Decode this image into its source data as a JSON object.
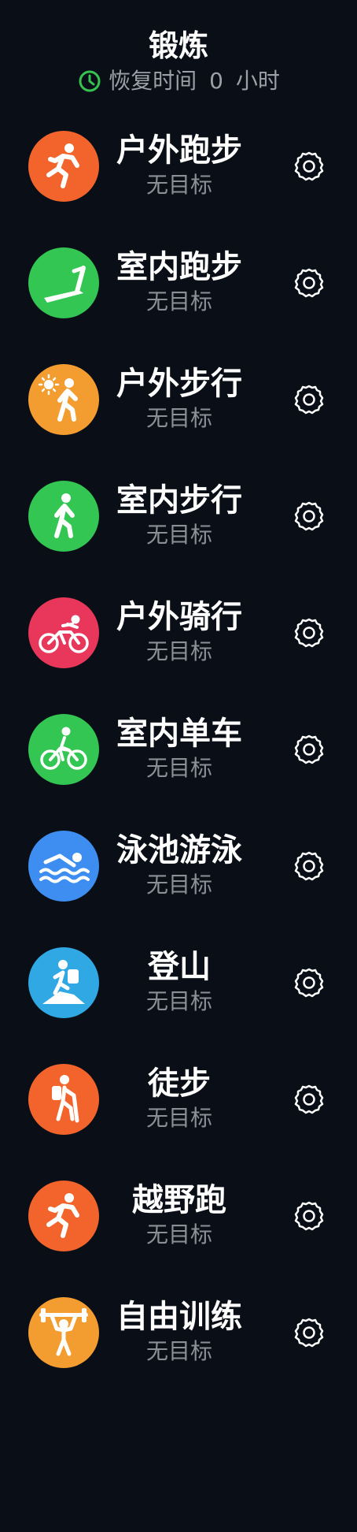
{
  "header": {
    "title": "锻炼",
    "recovery_label": "恢复时间",
    "recovery_value": "0",
    "recovery_unit": "小时",
    "recovery_icon": "clock-icon",
    "recovery_color": "#37c34f"
  },
  "workouts": [
    {
      "label": "户外跑步",
      "subtitle": "无目标",
      "icon": "running-icon",
      "color": "#f2642c"
    },
    {
      "label": "室内跑步",
      "subtitle": "无目标",
      "icon": "treadmill-icon",
      "color": "#33c653"
    },
    {
      "label": "户外步行",
      "subtitle": "无目标",
      "icon": "outdoor-walk-icon",
      "color": "#f39c30"
    },
    {
      "label": "室内步行",
      "subtitle": "无目标",
      "icon": "walking-icon",
      "color": "#33c653"
    },
    {
      "label": "户外骑行",
      "subtitle": "无目标",
      "icon": "cycling-icon",
      "color": "#e8375a"
    },
    {
      "label": "室内单车",
      "subtitle": "无目标",
      "icon": "indoor-bike-icon",
      "color": "#33c653"
    },
    {
      "label": "泳池游泳",
      "subtitle": "无目标",
      "icon": "swimming-icon",
      "color": "#3d8ef0"
    },
    {
      "label": "登山",
      "subtitle": "无目标",
      "icon": "climbing-icon",
      "color": "#2fa8e4"
    },
    {
      "label": "徒步",
      "subtitle": "无目标",
      "icon": "hiking-icon",
      "color": "#f2642c"
    },
    {
      "label": "越野跑",
      "subtitle": "无目标",
      "icon": "trail-run-icon",
      "color": "#f2642c"
    },
    {
      "label": "自由训练",
      "subtitle": "无目标",
      "icon": "weightlifting-icon",
      "color": "#f39c30"
    }
  ],
  "settings_icon": "gear-icon"
}
